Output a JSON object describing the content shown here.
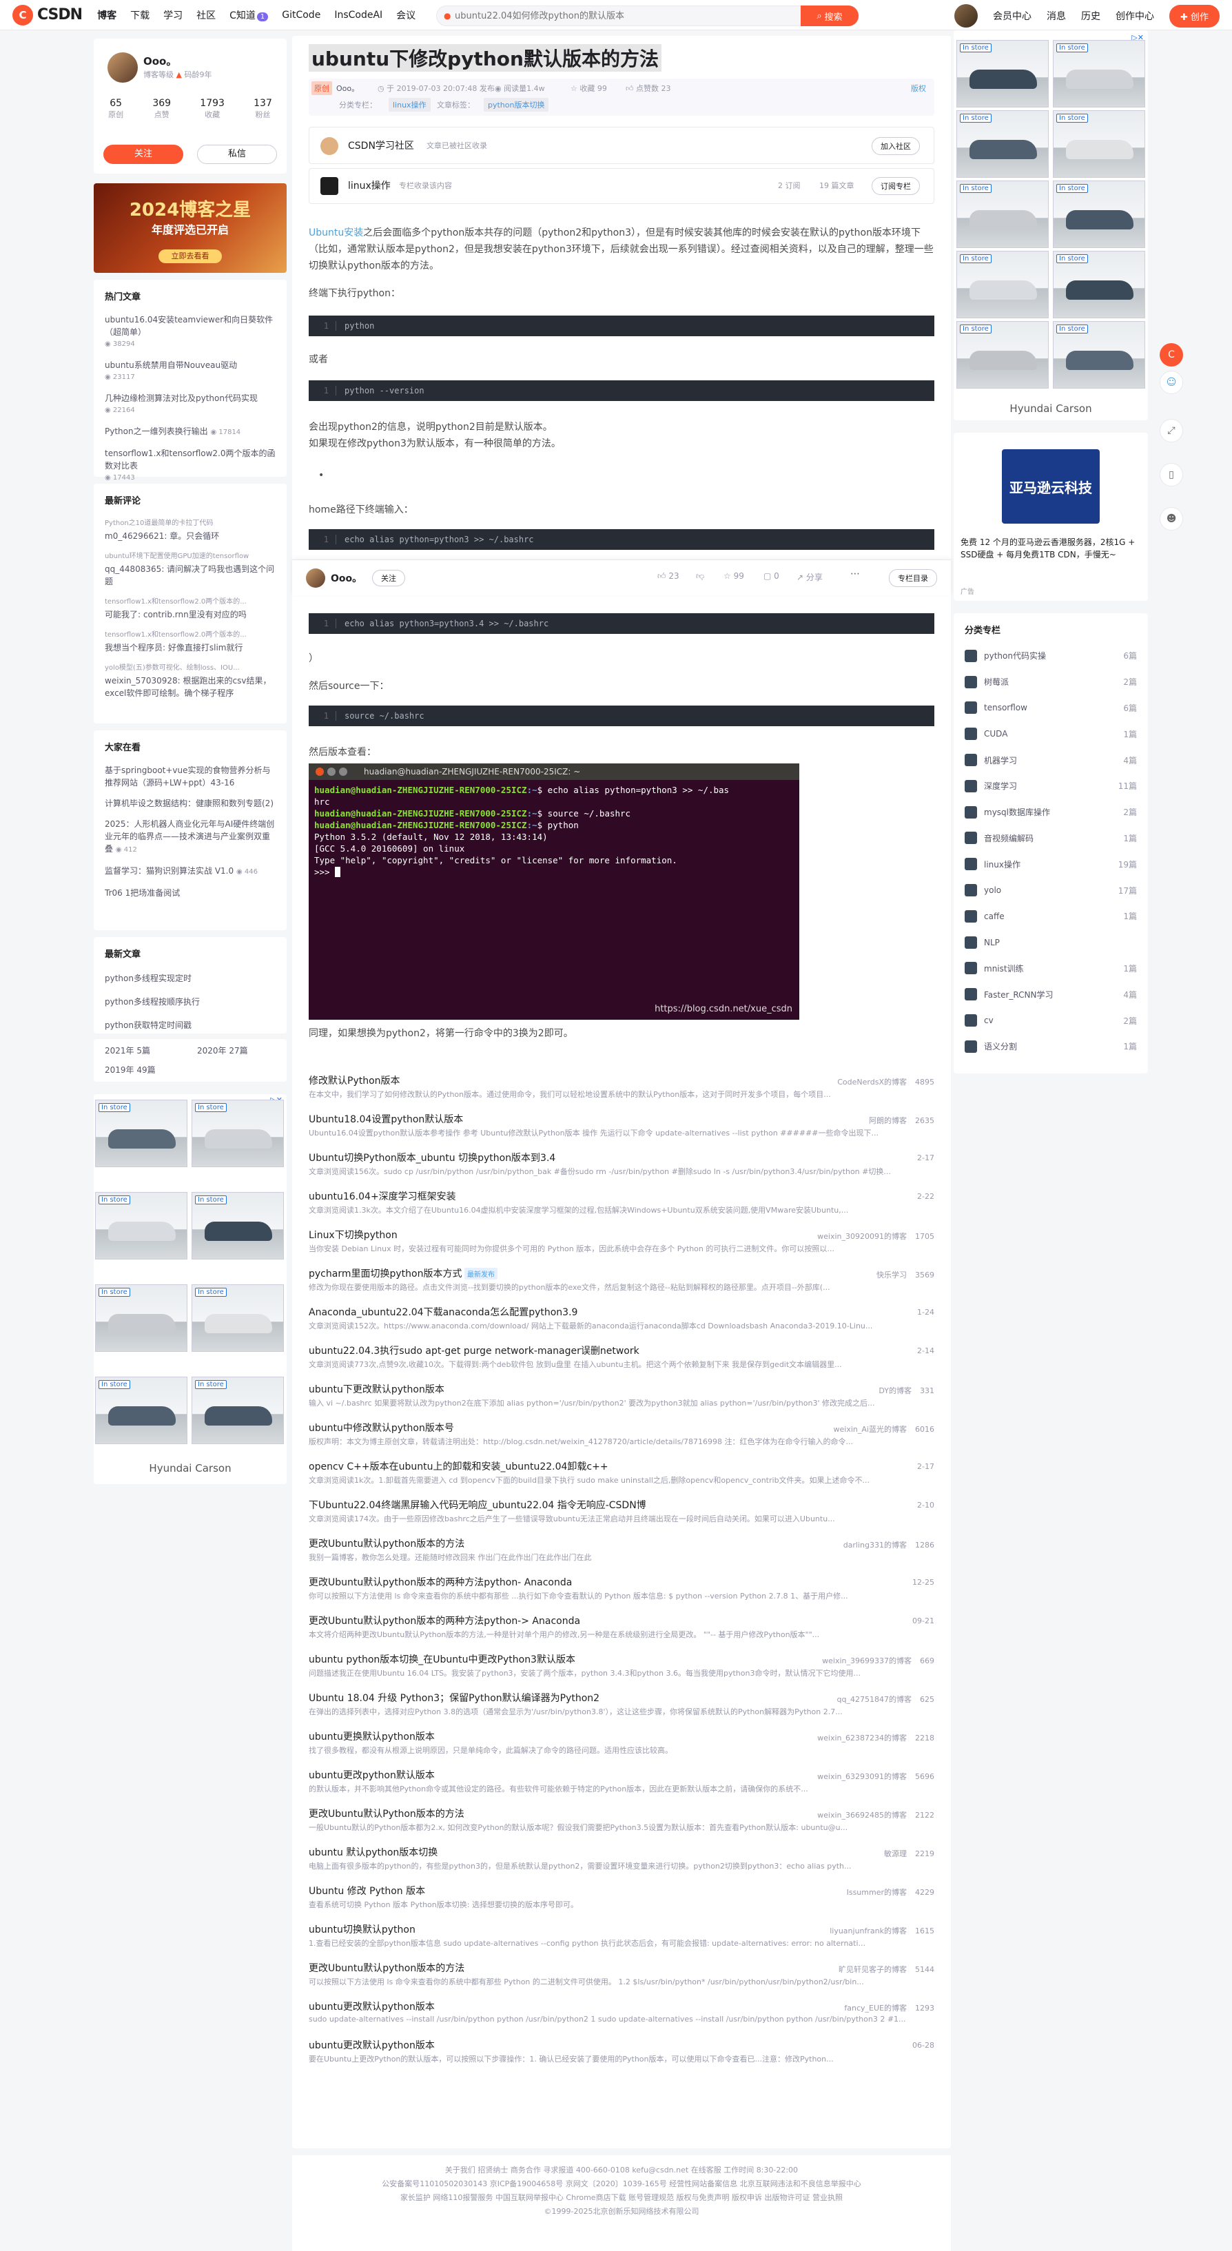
{
  "topnav": {
    "logo": "CSDN",
    "items": [
      "博客",
      "下载",
      "学习",
      "社区",
      "C知道",
      "GitCode",
      "InsCodeAI",
      "会议"
    ],
    "badge": "1",
    "search_placeholder": "ubuntu22.04如何修改python的默认版本",
    "search_button": "搜索",
    "right": [
      "会员中心",
      "消息",
      "历史",
      "创作中心"
    ],
    "create": "创作"
  },
  "profile": {
    "name": "Ooo。",
    "level": "博客等级",
    "years": "码龄9年",
    "stats": [
      {
        "value": "65",
        "label": "原创"
      },
      {
        "value": "369",
        "label": "点赞"
      },
      {
        "value": "1793",
        "label": "收藏"
      },
      {
        "value": "137",
        "label": "粉丝"
      }
    ],
    "follow": "关注",
    "message": "私信",
    "banner_title": "2024博客之星",
    "banner_sub": "年度评选已开启",
    "banner_btn": "立即去看看"
  },
  "hot_articles": {
    "title": "热门文章",
    "items": [
      {
        "title": "ubuntu16.04安装teamviewer和向日葵软件（超简单）",
        "views": "38294"
      },
      {
        "title": "ubuntu系统禁用自带Nouveau驱动",
        "views": "23117"
      },
      {
        "title": "几种边缘检测算法对比及python代码实现",
        "views": "22164"
      },
      {
        "title": "Python之一维列表换行输出",
        "views": "17814"
      },
      {
        "title": "tensorflow1.x和tensorflow2.0两个版本的函数对比表",
        "views": "17443"
      }
    ]
  },
  "recent_comments": {
    "title": "最新评论",
    "items": [
      {
        "title": "Python之10道最简单的卡拉丁代码",
        "text": "m0_46296621: 章。只会循环"
      },
      {
        "title": "ubuntu环境下配置使用GPU加速的tensorflow",
        "text": "qq_44808365: 请问解决了吗我也遇到这个问题"
      },
      {
        "title": "tensorflow1.x和tensorflow2.0两个版本的...",
        "text": "可能我了: contrib.rnn里没有对应的吗"
      },
      {
        "title": "tensorflow1.x和tensorflow2.0两个版本的...",
        "text": "我想当个程序员: 好像直接打slim就行"
      },
      {
        "title": "yolo模型(五)参数可视化、绘制loss、IOU...",
        "text": "weixin_57030928: 根据跑出来的csv结果，excel软件即可绘制。确个梯子程序"
      }
    ]
  },
  "featured": {
    "title": "大家在看",
    "items": [
      {
        "title": "基于springboot+vue实现的食物营养分析与推荐网站（源码+LW+ppt）43-16",
        "views": ""
      },
      {
        "title": "计算机毕设之数据结构：健康照和数列专题(2)",
        "views": ""
      },
      {
        "title": "2025：人形机器人商业化元年与AI硬件终端创业元年的临界点——技术演进与产业案例双重叠",
        "views": "412"
      },
      {
        "title": "监督学习：猫狗识别算法实战 V1.0",
        "views": "446"
      },
      {
        "title": "Tr06 1把场准备阅试",
        "views": ""
      }
    ]
  },
  "latest_articles": {
    "title": "最新文章",
    "items": [
      "python多线程实现定时",
      "python多线程按顺序执行",
      "python获取特定时间戳"
    ]
  },
  "archive": [
    {
      "year": "2021年",
      "count": "5篇"
    },
    {
      "year": "2020年",
      "count": "27篇"
    },
    {
      "year": "2019年",
      "count": "49篇"
    }
  ],
  "article": {
    "title": "ubuntu下修改python默认版本的方法",
    "type": "原创",
    "author": "Ooo。",
    "date": "于 2019-07-03 20:07:48 发布",
    "views": "阅读量1.4w",
    "favorites": "收藏 99",
    "likes": "点赞数 23",
    "copyright": "版权",
    "column_label": "分类专栏：",
    "column": "linux操作",
    "tag_label": "文章标签：",
    "tag": "python版本切换",
    "community_name": "CSDN学习社区",
    "community_sub": "文章已被社区收录",
    "community_btn": "加入社区",
    "col_name": "linux操作",
    "col_sub": "专栏收录该内容",
    "col_subs": "2 订阅",
    "col_count": "19 篇文章",
    "col_btn": "订阅专栏",
    "intro_link": "Ubuntu安装",
    "intro": "之后会面临多个python版本共存的问题（python2和python3），但是有时候安装其他库的时候会安装在默认的python版本环境下（比如，通常默认版本是python2，但是我想安装在python3环境下，后续就会出现一系列错误）。经过查阅相关资料，以及自己的理解，整理一些切换默认python版本的方法。",
    "p_terminal": "终端下执行python：",
    "code1": "python",
    "p_or": "或者",
    "code2": "python --version",
    "p_shows": "会出现python2的信息，说明python2目前是默认版本。",
    "p_change": "如果现在修改python3为默认版本，有一种很简单的方法。",
    "p_home": "home路径下终端输入：",
    "code3": "echo alias python=python3 >> ~/.bashrc",
    "code4": "echo alias python3=python3.4 >> ~/.bashrc",
    "p_paren": "）",
    "p_source": "然后source一下：",
    "code5": "source ~/.bashrc",
    "p_check": "然后版本查看：",
    "p_same": "同理，如果想换为python2，将第一行命令中的3换为2即可。",
    "terminal_title": "huadian@huadian-ZHENGJIUZHE-REN7000-25ICZ: ~",
    "terminal_user": "huadian@huadian-ZHENGJIUZHE-REN7000-25ICZ",
    "terminal_lines": [
      "$ echo alias python=python3 >> ~/.bas",
      "hrc",
      "$ source ~/.bashrc",
      "$ python",
      "Python 3.5.2 (default, Nov 12 2018, 13:43:14)",
      "[GCC 5.4.0 20160609] on linux",
      "Type \"help\", \"copyright\", \"credits\" or \"license\" for more information.",
      ">>> "
    ],
    "watermark": "https://blog.csdn.net/xue_csdn"
  },
  "action_bar": {
    "author": "Ooo。",
    "follow": "关注",
    "likes": "23",
    "favorites": "99",
    "comments": "0",
    "share": "分享",
    "column_btn": "专栏目录"
  },
  "recommendations": [
    {
      "title": "修改默认Python版本",
      "desc": "在本文中，我们学习了如何修改默认的Python版本。通过使用命令，我们可以轻松地设置系统中的默认Python版本，这对于同时开发多个项目，每个项目...",
      "meta": "CodeNerdsX的博客",
      "views": "4895"
    },
    {
      "title": "Ubuntu18.04设置python默认版本",
      "desc": "Ubuntu16.04设置python默认版本参考操作 参考 Ubuntu修改默认Python版本 操作 先运行以下命令 update-alternatives --list python ######一些命令出现下...",
      "meta": "阿朗的博客",
      "views": "2635"
    },
    {
      "title": "Ubuntu切换Python版本_ubuntu 切换python版本到3.4",
      "desc": "文章浏览阅读156次。sudo cp /usr/bin/python /usr/bin/python_bak #备份sudo rm -/usr/bin/python #删除sudo ln -s /usr/bin/python3.4/usr/bin/python #切换...",
      "meta": "",
      "views": "2-17"
    },
    {
      "title": "ubuntu16.04+深度学习框架安装",
      "desc": "文章浏览阅读1.3k次。本文介绍了在Ubuntu16.04虚拟机中安装深度学习框架的过程,包括解决Windows+Ubuntu双系统安装问题,使用VMware安装Ubuntu,...",
      "meta": "",
      "views": "2-22"
    },
    {
      "title": "Linux下切换python",
      "desc": "当你安装 Debian Linux 时，安装过程有可能同时为你提供多个可用的 Python 版本，因此系统中会存在多个 Python 的可执行二进制文件。你可以按照以...",
      "meta": "weixin_30920091的博客",
      "views": "1705"
    },
    {
      "title": "pycharm里面切换python版本方式",
      "desc": "修改为你现在要使用版本的路径。点击文件浏览--找到要切换的python版本的exe文件，然后复制这个路径--粘贴到解释权的路径那里。点开项目--外部库(...",
      "meta": "快乐学习",
      "views": "3569",
      "tag": "最新发布"
    },
    {
      "title": "Anaconda_ubuntu22.04下载anaconda怎么配置python3.9",
      "desc": "文章浏览阅读152次。https://www.anaconda.com/download/ 网站上下载最新的anaconda运行anaconda脚本cd Downloadsbash Anaconda3-2019.10-Linu...",
      "meta": "",
      "views": "1-24"
    },
    {
      "title": "ubuntu22.04.3执行sudo apt-get purge network-manager误删network",
      "desc": "文章浏览阅读773次,点赞9次,收藏10次。下载得到:两个deb软件包 放到u盘里 在插入ubuntu主机。把这个两个依赖复制下来 我是保存到gedit文本编辑器里...",
      "meta": "",
      "views": "2-14"
    },
    {
      "title": "ubuntu下更改默认python版本",
      "desc": "输入 vi ~/.bashrc 如果要将默认改为python2在底下添加 alias python='/usr/bin/python2' 要改为python3就加 alias python='/usr/bin/python3' 修改完成之后...",
      "meta": "DY的博客",
      "views": "331"
    },
    {
      "title": "ubuntu中修改默认python版本号",
      "desc": "版权声明：本文为博主原创文章，转载请注明出处：http://blog.csdn.net/weixin_41278720/article/details/78716998 注：红色字体为在命令行输入的命令...",
      "meta": "weixin_Ai蓝光的博客",
      "views": "6016"
    },
    {
      "title": "opencv C++版本在ubuntu上的卸载和安装_ubuntu22.04卸载c++",
      "desc": "文章浏览阅读1k次。1.卸载首先需要进入 cd 到opencv下面的build目录下执行 sudo make uninstall之后,删除opencv和opencv_contrib文件夹。如果上述命令不...",
      "meta": "",
      "views": "2-17"
    },
    {
      "title": "下Ubuntu22.04终端黑屏输入代码无响应_ubuntu22.04 指令无响应-CSDN博",
      "desc": "文章浏览阅读174次。由于一些原因修改bashrc之后产生了一些错误导致ubuntu无法正常启动并且终端出现在一段时间后自动关闭。如果可以进入Ubuntu...",
      "meta": "",
      "views": "2-10"
    },
    {
      "title": "更改Ubuntu默认python版本的方法",
      "desc": "我别一篇博客，教你怎么处理。还能随时修改回来 作出门在此作出门在此作出门在此",
      "meta": "darling331的博客",
      "views": "1286"
    },
    {
      "title": "更改Ubuntu默认python版本的两种方法python- Anaconda",
      "desc": "你可以按照以下方法使用 ls 命令来查看你的系统中都有那些 ...执行如下命令查看默认的 Python 版本信息: $ python --version Python 2.7.8 1、基于用户修...",
      "meta": "",
      "views": "12-25"
    },
    {
      "title": "更改Ubuntu默认python版本的两种方法python-> Anaconda",
      "desc": "本文将介绍两种更改Ubuntu默认Python版本的方法,一种是针对单个用户的修改,另一种是在系统级别进行全局更改。 \"\"-- 基于用户修改Python版本\"\"...",
      "meta": "",
      "views": "09-21"
    },
    {
      "title": "ubuntu python版本切换_在Ubuntu中更改Python3默认版本",
      "desc": "问题描述我正在使用Ubuntu 16.04 LTS。我安装了python3，安装了两个版本，python 3.4.3和python 3.6。每当我使用python3命令时，默认情况下它均使用...",
      "meta": "weixin_39699337的博客",
      "views": "669"
    },
    {
      "title": "Ubuntu 18.04 升级 Python3；保留Python默认编译器为Python2",
      "desc": "在弹出的选择列表中，选择对应Python 3.8的选项（通常会显示为'/usr/bin/python3.8'），这让这些步骤，你将保留系统默认的Python解释器为Python 2.7...",
      "meta": "qq_42751847的博客",
      "views": "625"
    },
    {
      "title": "ubuntu更换默认python版本",
      "desc": "找了很多教程，都没有从根源上说明原因，只是单纯命令，此篇解决了命令的路径问题。适用性应该比较高。",
      "meta": "weixin_62387234的博客",
      "views": "2218"
    },
    {
      "title": "ubuntu更改python默认版本",
      "desc": "的默认版本，并不影响其他Python命令或其他设定的路径。有些软件可能依赖于特定的Python版本，因此在更新默认版本之前，请确保你的系统不...",
      "meta": "weixin_63293091的博客",
      "views": "5696"
    },
    {
      "title": "更改Ubuntu默认Python版本的方法",
      "desc": "一般Ubuntu默认的Python版本都为2.x, 如何改变Python的默认版本呢？假设我们需要把Python3.5设置为默认版本：首先查看Python默认版本: ubuntu@u...",
      "meta": "weixin_36692485的博客",
      "views": "2122"
    },
    {
      "title": "ubuntu 默认python版本切换",
      "desc": "电脑上面有很多版本的python的，有些是python3的，但是系统默认是python2，需要设置环境变量来进行切换。python2切换到python3：echo alias pyth...",
      "meta": "敏源理",
      "views": "2219"
    },
    {
      "title": "Ubuntu 修改 Python 版本",
      "desc": "查看系统可切换 Python 版本 Python版本切换: 选择想要切换的版本序号即可。",
      "meta": "Issummer的博客",
      "views": "4229"
    },
    {
      "title": "ubuntu切换默认python",
      "desc": "1.查看已经安装的全部python版本信息 sudo update-alternatives --config python 执行此状态后会，有可能会报错: update-alternatives: error: no alternati...",
      "meta": "liyuanjunfrank的博客",
      "views": "1615"
    },
    {
      "title": "更改Ubuntu默认python版本的方法",
      "desc": "可以按照以下方法使用 ls 命令来查看你的系统中都有那些 Python 的二进制文件可供使用。 1.2 $ls/usr/bin/python* /usr/bin/python/usr/bin/python2/usr/bin...",
      "meta": "旷见轩见客子的博客",
      "views": "5144"
    },
    {
      "title": "ubuntu更改默认python版本",
      "desc": "sudo update-alternatives --install /usr/bin/python python /usr/bin/python2 1 sudo update-alternatives --install /usr/bin/python python /usr/bin/python3 2 #1...",
      "meta": "fancy_EUE的博客",
      "views": "1293"
    },
    {
      "title": "ubuntu更改默认python版本",
      "desc": "要在Ubuntu上更改Python的默认版本，可以按照以下步骤操作：1. 确认已经安装了要使用的Python版本，可以使用以下命令查看已...注意：修改Python...",
      "meta": "",
      "views": "06-28"
    }
  ],
  "right_ad": {
    "brand": "Hyundai Carson",
    "badge": "In store",
    "cloud_title": "亚马逊云科技",
    "cloud_desc": "免费 12 个月的亚马逊云香港服务器，2核1G + SSD硬盘 + 每月免费1TB CDN，手慢无~",
    "ad_label": "广告"
  },
  "categories": {
    "title": "分类专栏",
    "items": [
      {
        "name": "python代码实操",
        "count": "6篇"
      },
      {
        "name": "树莓派",
        "count": "2篇"
      },
      {
        "name": "tensorflow",
        "count": "6篇"
      },
      {
        "name": "CUDA",
        "count": "1篇"
      },
      {
        "name": "机器学习",
        "count": "4篇"
      },
      {
        "name": "深度学习",
        "count": "11篇"
      },
      {
        "name": "mysql数据库操作",
        "count": "2篇"
      },
      {
        "name": "音视频编解码",
        "count": "1篇"
      },
      {
        "name": "linux操作",
        "count": "19篇"
      },
      {
        "name": "yolo",
        "count": "17篇"
      },
      {
        "name": "caffe",
        "count": "1篇"
      },
      {
        "name": "NLP",
        "count": ""
      },
      {
        "name": "mnist训练",
        "count": "1篇"
      },
      {
        "name": "Faster_RCNN学习",
        "count": "4篇"
      },
      {
        "name": "cv",
        "count": "2篇"
      },
      {
        "name": "语义分割",
        "count": "1篇"
      }
    ]
  },
  "footer": {
    "line1": "关于我们  招贤纳士  商务合作  寻求报道  400-660-0108  kefu@csdn.net  在线客服  工作时间 8:30-22:00",
    "line2": "公安备案号11010502030143  京ICP备19004658号  京网文〔2020〕1039-165号  经营性网站备案信息  北京互联网违法和不良信息举报中心",
    "line3": "家长监护  网络110报警服务  中国互联网举报中心  Chrome商店下载  账号管理规范  版权与免责声明  版权申诉  出版物许可证  营业执照",
    "line4": "©1999-2025北京创新乐知网络技术有限公司"
  }
}
